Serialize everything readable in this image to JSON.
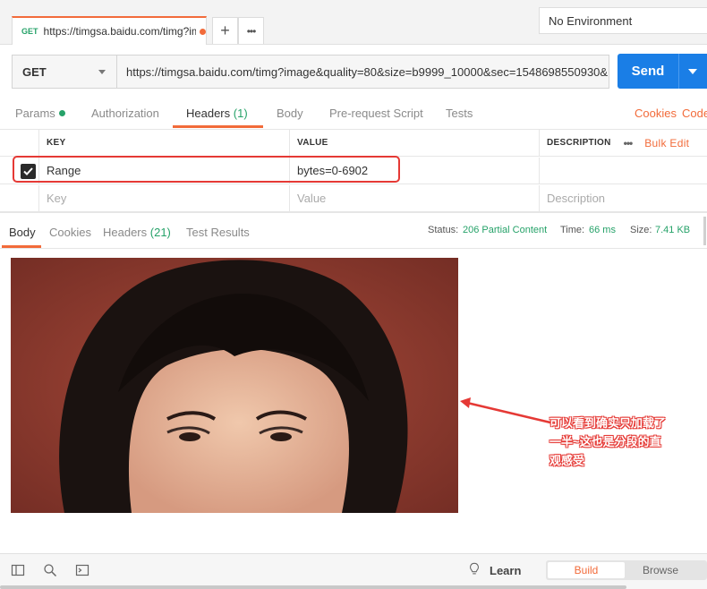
{
  "tabs": {
    "active": {
      "method": "GET",
      "title": "https://timgsa.baidu.com/timg?image"
    },
    "new_tab": "+",
    "more": "•••"
  },
  "environment": {
    "label": "No Environment"
  },
  "request": {
    "method": "GET",
    "url": "https://timgsa.baidu.com/timg?image&quality=80&size=b9999_10000&sec=1548698550930&...",
    "send_label": "Send"
  },
  "request_tabs": {
    "params": "Params",
    "authorization": "Authorization",
    "headers": "Headers",
    "headers_count": "(1)",
    "body": "Body",
    "prerequest": "Pre-request Script",
    "tests": "Tests",
    "cookies": "Cookies",
    "code": "Code"
  },
  "headers_table": {
    "columns": {
      "key": "KEY",
      "value": "VALUE",
      "description": "DESCRIPTION",
      "more": "•••",
      "bulk_edit": "Bulk Edit"
    },
    "rows": [
      {
        "key": "Range",
        "value": "bytes=0-6902",
        "description": ""
      }
    ],
    "placeholders": {
      "key": "Key",
      "value": "Value",
      "description": "Description"
    }
  },
  "response_tabs": {
    "body": "Body",
    "cookies": "Cookies",
    "headers": "Headers",
    "headers_count": "(21)",
    "test_results": "Test Results"
  },
  "status": {
    "status_label": "Status:",
    "status_value": "206 Partial Content",
    "time_label": "Time:",
    "time_value": "66 ms",
    "size_label": "Size:",
    "size_value": "7.41 KB"
  },
  "annotation": {
    "line1": "可以看到确实只加载了",
    "line2": "一半~这也是分段的直",
    "line3": "观感受",
    "color": "#e53935"
  },
  "footer": {
    "learn": "Learn",
    "build": "Build",
    "browse": "Browse"
  },
  "colors": {
    "accent": "#f26b3a",
    "send": "#1a7ee6",
    "success": "#26a269"
  }
}
